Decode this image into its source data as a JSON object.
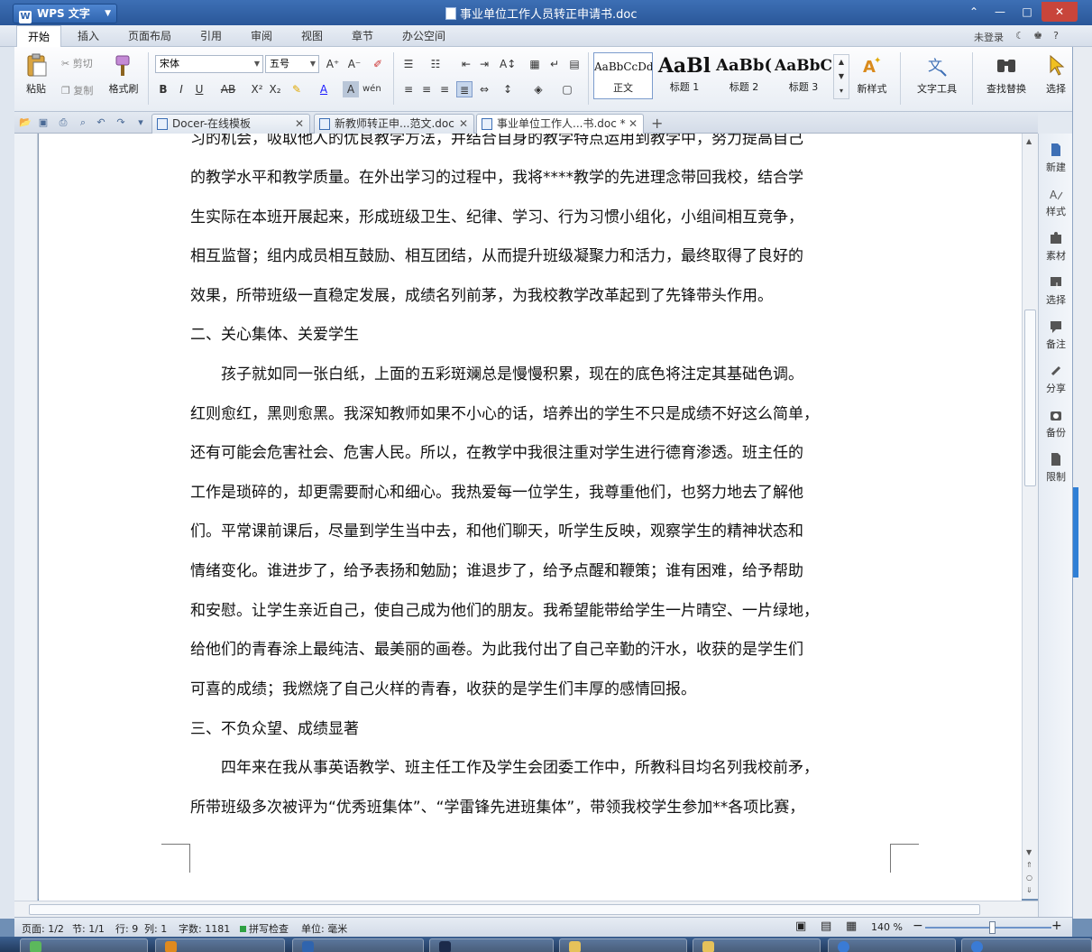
{
  "app": {
    "name": "WPS 文字",
    "doc_title": "事业单位工作人员转正申请书.doc"
  },
  "menu": {
    "tabs": [
      "开始",
      "插入",
      "页面布局",
      "引用",
      "审阅",
      "视图",
      "章节",
      "办公空间"
    ],
    "login": "未登录"
  },
  "ribbon": {
    "paste": "粘贴",
    "cut": "剪切",
    "copy": "复制",
    "format_painter": "格式刷",
    "font_name": "宋体",
    "font_size": "五号",
    "styles": [
      {
        "sample": "AaBbCcDd",
        "label": "正文"
      },
      {
        "sample": "AaBl",
        "label": "标题 1"
      },
      {
        "sample": "AaBb(",
        "label": "标题 2"
      },
      {
        "sample": "AaBbC",
        "label": "标题 3"
      }
    ],
    "new_style": "新样式",
    "text_tools": "文字工具",
    "find_replace": "查找替换",
    "select": "选择"
  },
  "doc_tabs": [
    {
      "label": "Docer-在线模板"
    },
    {
      "label": "新教师转正申...范文.doc"
    },
    {
      "label": "事业单位工作人...书.doc *"
    }
  ],
  "document": {
    "lines": [
      "习的机会，吸取他人的优良教学方法，并结合自身的教学特点运用到教学中，努力提高自己",
      "的教学水平和教学质量。在外出学习的过程中，我将****教学的先进理念带回我校，结合学",
      "生实际在本班开展起来，形成班级卫生、纪律、学习、行为习惯小组化，小组间相互竞争，",
      "相互监督；组内成员相互鼓励、相互团结，从而提升班级凝聚力和活力，最终取得了良好的",
      "效果，所带班级一直稳定发展，成绩名列前茅，为我校教学改革起到了先锋带头作用。",
      "二、关心集体、关爱学生",
      "　　孩子就如同一张白纸，上面的五彩斑斓总是慢慢积累，现在的底色将注定其基础色调。",
      "红则愈红，黑则愈黑。我深知教师如果不小心的话，培养出的学生不只是成绩不好这么简单，",
      "还有可能会危害社会、危害人民。所以，在教学中我很注重对学生进行德育渗透。班主任的",
      "工作是琐碎的，却更需要耐心和细心。我热爱每一位学生，我尊重他们，也努力地去了解他",
      "们。平常课前课后，尽量到学生当中去，和他们聊天，听学生反映，观察学生的精神状态和",
      "情绪变化。谁进步了，给予表扬和勉励；谁退步了，给予点醒和鞭策；谁有困难，给予帮助",
      "和安慰。让学生亲近自己，使自己成为他们的朋友。我希望能带给学生一片晴空、一片绿地，",
      "给他们的青春涂上最纯洁、最美丽的画卷。为此我付出了自己辛勤的汗水，收获的是学生们",
      "可喜的成绩；我燃烧了自己火样的青春，收获的是学生们丰厚的感情回报。",
      "三、不负众望、成绩显著",
      "　　四年来在我从事英语教学、班主任工作及学生会团委工作中，所教科目均名列我校前矛，",
      "所带班级多次被评为“优秀班集体”、“学雷锋先进班集体”，带领我校学生参加**各项比赛，"
    ]
  },
  "right_pane": [
    "新建",
    "样式",
    "素材",
    "选择",
    "备注",
    "分享",
    "备份",
    "限制"
  ],
  "status": {
    "page": "页面: 1/2",
    "section": "节: 1/1",
    "row": "行: 9",
    "col": "列: 1",
    "words": "字数: 1181",
    "spell": "拼写检查",
    "unit": "单位: 毫米",
    "zoom": "140 %"
  },
  "colors": {
    "title_bar": "#2a5799",
    "accent": "#3d6fb5",
    "close": "#c8453b"
  }
}
